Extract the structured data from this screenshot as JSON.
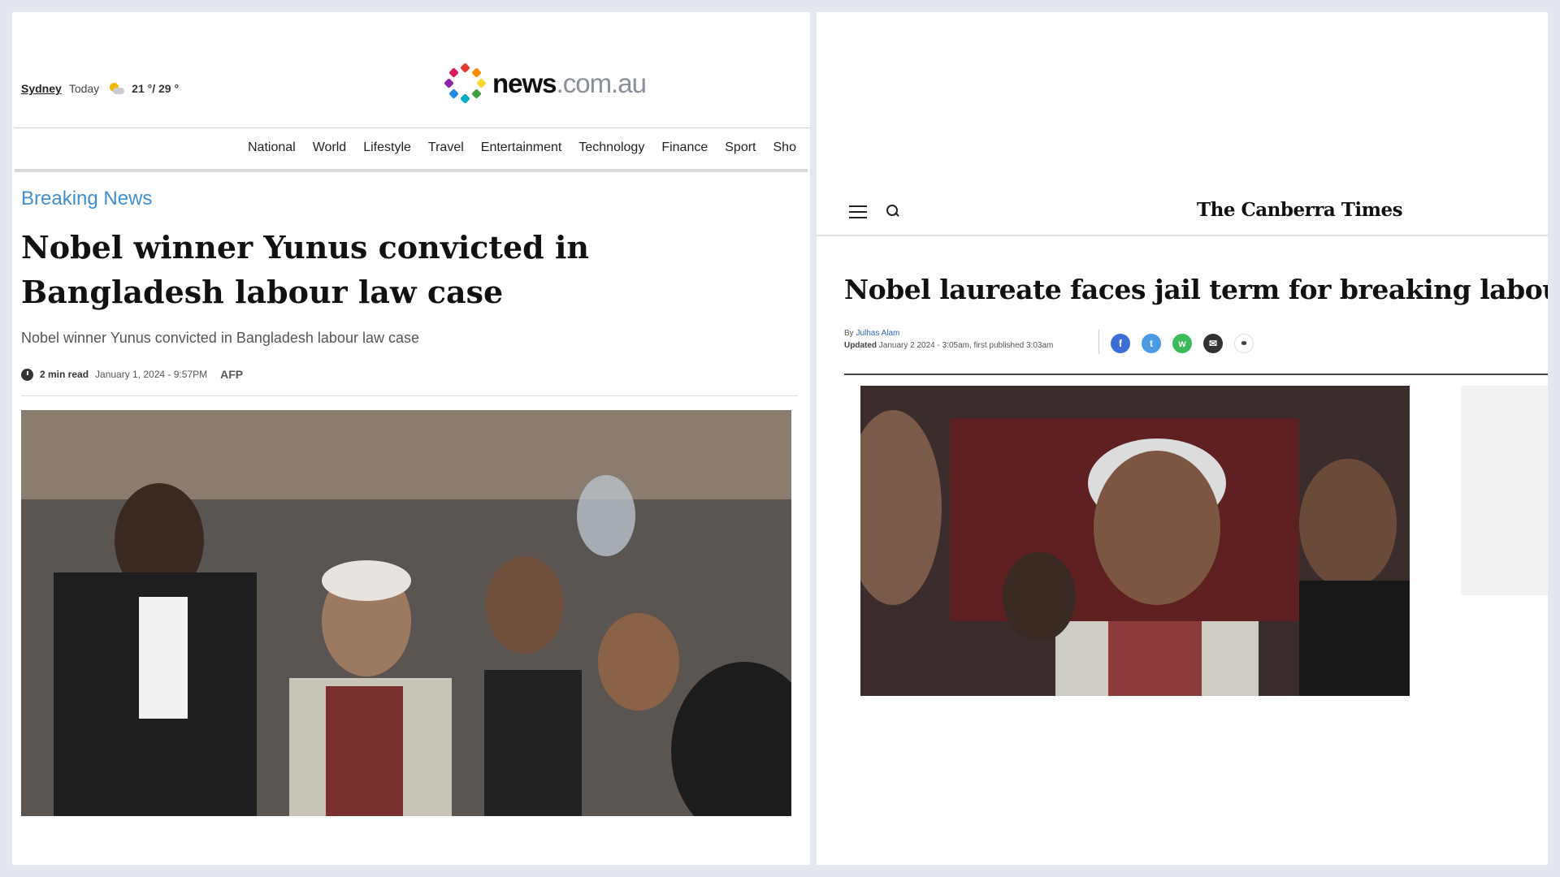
{
  "left": {
    "location": {
      "city": "Sydney",
      "day": "Today",
      "temp": "21 °/ 29 °"
    },
    "brand": {
      "bold": "news",
      "domain": ".com.au"
    },
    "nav": [
      "National",
      "World",
      "Lifestyle",
      "Travel",
      "Entertainment",
      "Technology",
      "Finance",
      "Sport",
      "Sho"
    ],
    "kicker": "Breaking News",
    "headline": "Nobel winner Yunus convicted in Bangladesh labour law case",
    "subheadline": "Nobel winner Yunus convicted in Bangladesh labour law case",
    "meta": {
      "read_time": "2 min read",
      "date": "January 1, 2024 - 9:57PM",
      "source": "AFP"
    }
  },
  "right": {
    "brand": "The Canberra Times",
    "headline": "Nobel laureate faces jail term for breaking labour laws",
    "byline": {
      "by": "By",
      "author": "Julhas Alam",
      "updated_label": "Updated",
      "updated": "January 2 2024 - 3:05am, first published 3:03am"
    },
    "share_icons": [
      "facebook-icon",
      "twitter-icon",
      "whatsapp-icon",
      "email-icon",
      "link-icon"
    ]
  },
  "colors": {
    "kicker": "#3f8fd0",
    "facebook": "#3b6fd6",
    "twitter": "#4a9ae4",
    "whatsapp": "#3dbb5c",
    "email": "#333333"
  }
}
